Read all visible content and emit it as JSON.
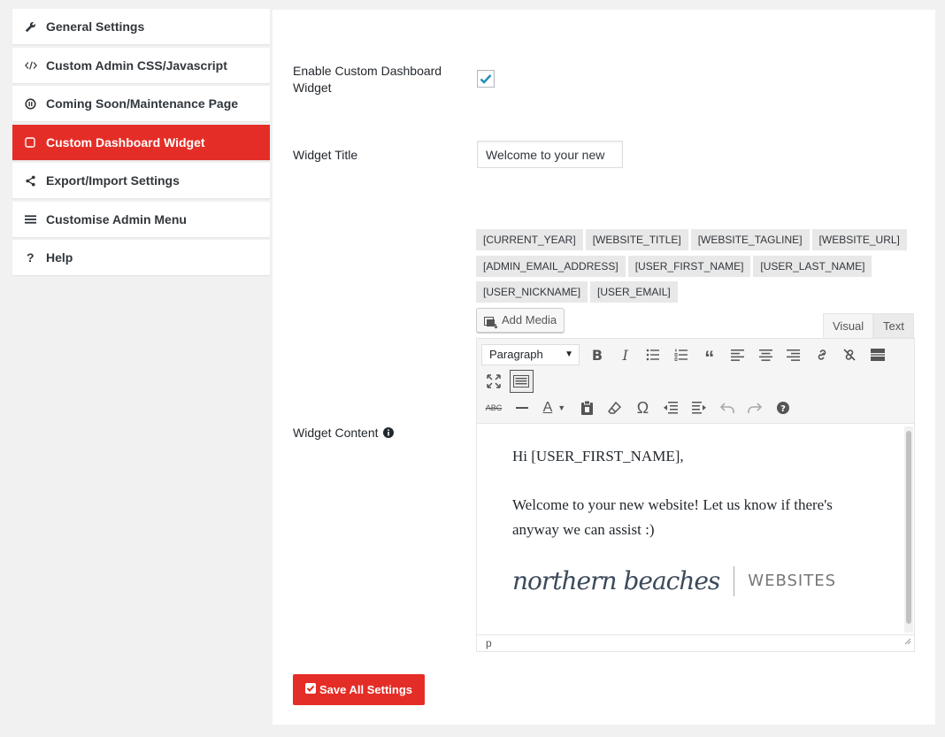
{
  "sidebar": {
    "items": [
      {
        "label": "General Settings",
        "icon": "wrench-icon"
      },
      {
        "label": "Custom Admin CSS/Javascript",
        "icon": "code-icon"
      },
      {
        "label": "Coming Soon/Maintenance Page",
        "icon": "pause-circle-icon"
      },
      {
        "label": "Custom Dashboard Widget",
        "icon": "square-icon"
      },
      {
        "label": "Export/Import Settings",
        "icon": "share-icon"
      },
      {
        "label": "Customise Admin Menu",
        "icon": "menu-icon"
      },
      {
        "label": "Help",
        "icon": "question-icon"
      }
    ]
  },
  "form": {
    "enable_label": "Enable Custom Dashboard Widget",
    "enable_checked": true,
    "title_label": "Widget Title",
    "title_value": "Welcome to your new",
    "content_label": "Widget Content",
    "tags": [
      "[CURRENT_YEAR]",
      "[WEBSITE_TITLE]",
      "[WEBSITE_TAGLINE]",
      "[WEBSITE_URL]",
      "[ADMIN_EMAIL_ADDRESS]",
      "[USER_FIRST_NAME]",
      "[USER_LAST_NAME]",
      "[USER_NICKNAME]",
      "[USER_EMAIL]"
    ]
  },
  "editor": {
    "add_media": "Add Media",
    "tab_visual": "Visual",
    "tab_text": "Text",
    "format_value": "Paragraph",
    "line1": "Hi [USER_FIRST_NAME],",
    "line2": "Welcome to your new website! Let us know if there's anyway we can assist :)",
    "logo_script": "northern beaches",
    "logo_sans": "WEBSITES",
    "status_path": "p"
  },
  "save_label": "Save All Settings",
  "colors": {
    "accent": "#e52d27",
    "check": "#1e8cbe"
  }
}
